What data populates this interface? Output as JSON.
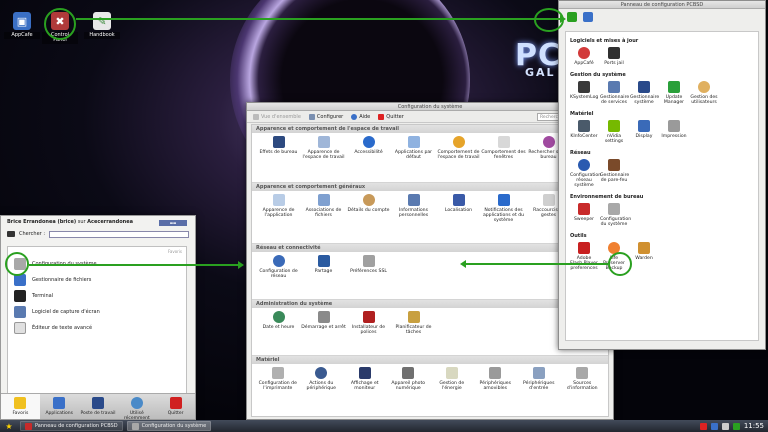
{
  "desktop": {
    "icons": [
      {
        "label": "AppCafe"
      },
      {
        "label": "Control Panel"
      },
      {
        "label": "Handbook"
      }
    ],
    "wallpaper_text": {
      "logo": "PC",
      "subtitle": "GAL"
    }
  },
  "sysconfig_window": {
    "title": "Configuration du système",
    "toolbar": {
      "overview": "Vue d'ensemble",
      "configure": "Configurer",
      "help": "Aide",
      "quit": "Quitter",
      "search_placeholder": "Rechercher"
    },
    "sections": [
      {
        "title": "Apparence et comportement de l'espace de travail",
        "items": [
          "Effets de bureau",
          "Apparence de l'espace de travail",
          "Accessibilité",
          "Applications par défaut",
          "Comportement de l'espace de travail",
          "Comportement des fenêtres",
          "Rechercher sur le bureau"
        ]
      },
      {
        "title": "Apparence et comportement généraux",
        "items": [
          "Apparence de l'application",
          "Associations de fichiers",
          "Détails du compte",
          "Informations personnelles",
          "Localisation",
          "Notifications des applications et du système",
          "Raccourcis et gestes"
        ]
      },
      {
        "title": "Réseau et connectivité",
        "items": [
          "Configuration de réseau",
          "Partage",
          "Préférences SSL"
        ]
      },
      {
        "title": "Administration du système",
        "items": [
          "Date et heure",
          "Démarrage et arrêt",
          "Installateur de polices",
          "Planificateur de tâches"
        ]
      },
      {
        "title": "Matériel",
        "items": [
          "Configuration de l'imprimante",
          "Actions du périphérique",
          "Affichage et moniteur",
          "Appareil photo numérique",
          "Gestion de l'énergie",
          "Périphériques amovibles",
          "Périphériques d'entrée",
          "Sources d'information"
        ]
      }
    ]
  },
  "pcbsd_panel": {
    "title": "Panneau de configuration PCBSD",
    "sections": [
      {
        "title": "Logiciels et mises à jour",
        "items": [
          "AppCafé",
          "Ports jail"
        ]
      },
      {
        "title": "Gestion du système",
        "items": [
          "KSystemLog",
          "Gestionnaire de services",
          "Gestionnaire système",
          "Update Manager",
          "Gestion des utilisateurs"
        ]
      },
      {
        "title": "Matériel",
        "items": [
          "KInfoCenter",
          "nVidia settings",
          "Display",
          "Impression"
        ]
      },
      {
        "title": "Réseau",
        "items": [
          "Configuration réseau système",
          "Gestionnaire de pare-feu"
        ]
      },
      {
        "title": "Environnement de bureau",
        "items": [
          "Sweeper",
          "Configuration du système"
        ]
      },
      {
        "title": "Outils",
        "items": [
          "Adobe Flash Player preferences",
          "Life Preserver Backup",
          "Warden"
        ]
      }
    ]
  },
  "kickoff": {
    "user_name": "Brice Errandonea (brice)",
    "on_word": "sur",
    "host": "Acecerrandonea",
    "search_label": "Chercher :",
    "favorites_label": "Favoris",
    "favorites": [
      "Configuration du système",
      "Gestionnaire de fichiers",
      "Terminal",
      "Logiciel de capture d'écran",
      "Éditeur de texte avancé"
    ],
    "tabs": [
      "Favoris",
      "Applications",
      "Poste de travail",
      "Utilisé récemment",
      "Quitter"
    ]
  },
  "taskbar": {
    "tasks": [
      "Panneau de configuration PCBSD",
      "Configuration du système"
    ],
    "clock": "11:55"
  },
  "colors": {
    "highlight": "#2aa020",
    "taskbar": "#2b303b"
  }
}
